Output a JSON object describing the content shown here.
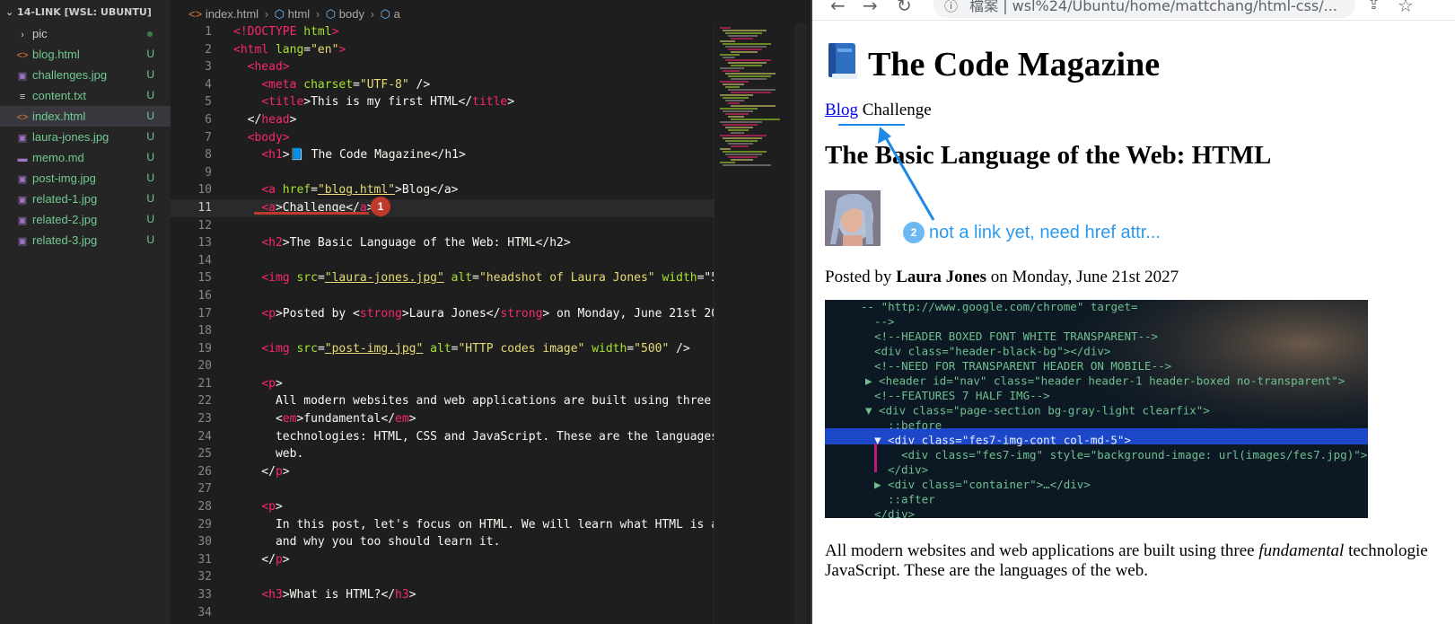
{
  "sidebar": {
    "title": "14-LINK [WSL: UBUNTU]",
    "items": [
      {
        "label": "pic",
        "badge": "",
        "type": "folder",
        "color": "#cccccc"
      },
      {
        "label": "blog.html",
        "badge": "U",
        "type": "html",
        "color": "#73c991"
      },
      {
        "label": "challenges.jpg",
        "badge": "U",
        "type": "image",
        "color": "#73c991"
      },
      {
        "label": "content.txt",
        "badge": "U",
        "type": "text",
        "color": "#73c991"
      },
      {
        "label": "index.html",
        "badge": "U",
        "type": "html",
        "color": "#73c991"
      },
      {
        "label": "laura-jones.jpg",
        "badge": "U",
        "type": "image",
        "color": "#73c991"
      },
      {
        "label": "memo.md",
        "badge": "U",
        "type": "markdown",
        "color": "#73c991"
      },
      {
        "label": "post-img.jpg",
        "badge": "U",
        "type": "image",
        "color": "#73c991"
      },
      {
        "label": "related-1.jpg",
        "badge": "U",
        "type": "image",
        "color": "#73c991"
      },
      {
        "label": "related-2.jpg",
        "badge": "U",
        "type": "image",
        "color": "#73c991"
      },
      {
        "label": "related-3.jpg",
        "badge": "U",
        "type": "image",
        "color": "#73c991"
      }
    ]
  },
  "breadcrumb": {
    "file": "index.html",
    "p1": "html",
    "p2": "body",
    "p3": "a"
  },
  "editor": {
    "current_line": 11,
    "lines": [
      [
        [
          "t-tag",
          "<!"
        ],
        [
          "t-tag",
          "DOCTYPE"
        ],
        [
          "t-attr",
          " html"
        ],
        [
          "t-tag",
          ">"
        ]
      ],
      [
        [
          "t-tag",
          "<html"
        ],
        [
          "t-attr",
          " lang"
        ],
        [
          "t-plain",
          "="
        ],
        [
          "t-str",
          "\"en\""
        ],
        [
          "t-tag",
          ">"
        ]
      ],
      [
        [
          "t-plain",
          "  "
        ],
        [
          "t-tag",
          "<head>"
        ]
      ],
      [
        [
          "t-plain",
          "    "
        ],
        [
          "t-tag",
          "<meta"
        ],
        [
          "t-attr",
          " charset"
        ],
        [
          "t-plain",
          "="
        ],
        [
          "t-str",
          "\"UTF-8\""
        ],
        [
          "t-plain",
          " />"
        ]
      ],
      [
        [
          "t-plain",
          "    "
        ],
        [
          "t-tag",
          "<title"
        ],
        [
          "t-plain",
          ">This is my first HTML</"
        ],
        [
          "t-tag",
          "title"
        ],
        [
          "t-plain",
          ">"
        ]
      ],
      [
        [
          "t-plain",
          "  "
        ],
        [
          "t-plain",
          "</"
        ],
        [
          "t-tag",
          "head"
        ],
        [
          "t-plain",
          ">"
        ]
      ],
      [
        [
          "t-plain",
          "  "
        ],
        [
          "t-tag",
          "<body>"
        ]
      ],
      [
        [
          "t-plain",
          "    "
        ],
        [
          "t-tag",
          "<h1"
        ],
        [
          "t-plain",
          ">📘 The Code Magazine</h1>"
        ]
      ],
      [
        [
          "t-plain",
          ""
        ]
      ],
      [
        [
          "t-plain",
          "    "
        ],
        [
          "t-tag",
          "<a"
        ],
        [
          "t-attr",
          " href"
        ],
        [
          "t-plain",
          "="
        ],
        [
          "t-str",
          "\"blog.html\""
        ],
        [
          "t-plain",
          ">Blog</a>"
        ]
      ],
      [
        [
          "t-plain",
          "    "
        ],
        [
          "t-tag",
          "<a"
        ],
        [
          "t-plain",
          ">Challenge</"
        ],
        [
          "t-tag",
          "a"
        ],
        [
          "t-plain",
          ">"
        ]
      ],
      [
        [
          "t-plain",
          ""
        ]
      ],
      [
        [
          "t-plain",
          "    "
        ],
        [
          "t-tag",
          "<h2"
        ],
        [
          "t-plain",
          ">The Basic Language of the Web: HTML</h2>"
        ]
      ],
      [
        [
          "t-plain",
          ""
        ]
      ],
      [
        [
          "t-plain",
          "    "
        ],
        [
          "t-tag",
          "<img"
        ],
        [
          "t-attr",
          " src"
        ],
        [
          "t-plain",
          "="
        ],
        [
          "t-str",
          "\"laura-jones.jpg\""
        ],
        [
          "t-attr",
          " alt"
        ],
        [
          "t-plain",
          "="
        ],
        [
          "t-str",
          "\"headshot of Laura Jones\""
        ],
        [
          "t-attr",
          " width"
        ],
        [
          "t-plain",
          "=\"5"
        ]
      ],
      [
        [
          "t-plain",
          ""
        ]
      ],
      [
        [
          "t-plain",
          "    "
        ],
        [
          "t-tag",
          "<p"
        ],
        [
          "t-plain",
          ">Posted by <"
        ],
        [
          "t-tag",
          "strong"
        ],
        [
          "t-plain",
          ">Laura Jones</"
        ],
        [
          "t-tag",
          "strong"
        ],
        [
          "t-plain",
          "> on Monday, June 21st 20"
        ]
      ],
      [
        [
          "t-plain",
          ""
        ]
      ],
      [
        [
          "t-plain",
          "    "
        ],
        [
          "t-tag",
          "<img"
        ],
        [
          "t-attr",
          " src"
        ],
        [
          "t-plain",
          "="
        ],
        [
          "t-str",
          "\"post-img.jpg\""
        ],
        [
          "t-attr",
          " alt"
        ],
        [
          "t-plain",
          "="
        ],
        [
          "t-str",
          "\"HTTP codes image\""
        ],
        [
          "t-attr",
          " width"
        ],
        [
          "t-plain",
          "="
        ],
        [
          "t-str",
          "\"500\""
        ],
        [
          "t-plain",
          " />"
        ]
      ],
      [
        [
          "t-plain",
          ""
        ]
      ],
      [
        [
          "t-plain",
          "    "
        ],
        [
          "t-tag",
          "<p"
        ],
        [
          "t-plain",
          ">"
        ]
      ],
      [
        [
          "t-plain",
          "      All modern websites and web applications are built using three"
        ]
      ],
      [
        [
          "t-plain",
          "      <"
        ],
        [
          "t-tag",
          "em"
        ],
        [
          "t-plain",
          ">fundamental</"
        ],
        [
          "t-tag",
          "em"
        ],
        [
          "t-plain",
          ">"
        ]
      ],
      [
        [
          "t-plain",
          "      technologies: HTML, CSS and JavaScript. These are the languages"
        ]
      ],
      [
        [
          "t-plain",
          "      web."
        ]
      ],
      [
        [
          "t-plain",
          "    </"
        ],
        [
          "t-tag",
          "p"
        ],
        [
          "t-plain",
          ">"
        ]
      ],
      [
        [
          "t-plain",
          ""
        ]
      ],
      [
        [
          "t-plain",
          "    "
        ],
        [
          "t-tag",
          "<p"
        ],
        [
          "t-plain",
          ">"
        ]
      ],
      [
        [
          "t-plain",
          "      In this post, let's focus on HTML. We will learn what HTML is a"
        ]
      ],
      [
        [
          "t-plain",
          "      and why you too should learn it."
        ]
      ],
      [
        [
          "t-plain",
          "    </"
        ],
        [
          "t-tag",
          "p"
        ],
        [
          "t-plain",
          ">"
        ]
      ],
      [
        [
          "t-plain",
          ""
        ]
      ],
      [
        [
          "t-plain",
          "    "
        ],
        [
          "t-tag",
          "<h3"
        ],
        [
          "t-plain",
          ">What is HTML?</"
        ],
        [
          "t-tag",
          "h3"
        ],
        [
          "t-plain",
          ">"
        ]
      ],
      [
        [
          "t-plain",
          ""
        ]
      ]
    ],
    "marker_number": "1"
  },
  "browser": {
    "address": "檔案  |  wsl%24/Ubuntu/home/mattchang/html-css/...",
    "h1": "The Code Magazine",
    "link_blog": "Blog",
    "link_challenge": "Challenge",
    "h2": "The Basic Language of the Web: HTML",
    "posted_prefix": "Posted by ",
    "posted_author": "Laura Jones",
    "posted_suffix": " on Monday, June 21st 2027",
    "para1_a": "All modern websites and web applications are built using three ",
    "para1_em": "fundamental",
    "para1_b": " technologie",
    "para1_line2": "JavaScript. These are the languages of the web.",
    "post_img_lines": [
      "  --  \"http://www.google.com/chrome\" target=",
      "  -->",
      "  <!--HEADER BOXED FONT WHITE TRANSPARENT-->",
      "  <div class=\"header-black-bg\"></div>",
      "  <!--NEED FOR TRANSPARENT HEADER ON MOBILE-->",
      "▶ <header id=\"nav\" class=\"header header-1 header-boxed no-transparent\">",
      "  <!--FEATURES 7 HALF IMG-->",
      "▼ <div class=\"page-section bg-gray-light clearfix\">",
      "    ::before",
      "  ▼ <div class=\"fes7-img-cont col-md-5\">",
      "      <div class=\"fes7-img\" style=\"background-image: url(images/fes7.jpg)\">",
      "    </div>",
      "  ▶ <div class=\"container\">…</div>",
      "    ::after",
      "  </div>"
    ]
  },
  "annotation": {
    "marker_number": "2",
    "text": "not a link yet, need href attr..."
  }
}
